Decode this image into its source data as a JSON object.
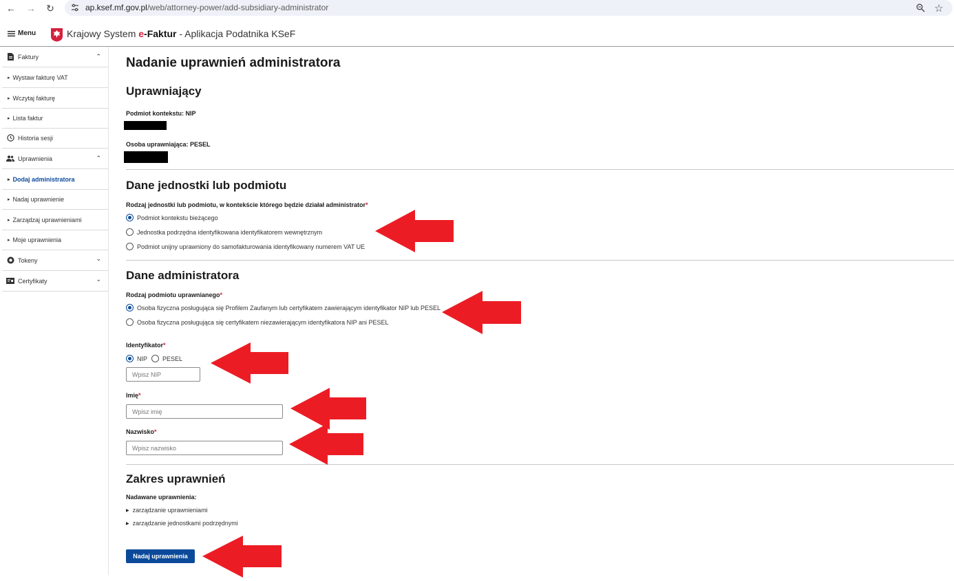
{
  "browser": {
    "url_host": "ap.ksef.mf.gov.pl",
    "url_path": "/web/attorney-power/add-subsidiary-administrator"
  },
  "header": {
    "menu_label": "Menu",
    "title_prefix": "Krajowy System ",
    "title_e": "e",
    "title_brand": "-Faktur",
    "title_suffix": " - Aplikacja Podatnika KSeF"
  },
  "sidebar": {
    "items": [
      {
        "label": "Faktury",
        "icon": "document-icon",
        "expanded": true
      },
      {
        "label": "Wystaw fakturę VAT"
      },
      {
        "label": "Wczytaj fakturę"
      },
      {
        "label": "Lista faktur"
      },
      {
        "label": "Historia sesji",
        "icon": "clock-icon"
      },
      {
        "label": "Uprawnienia",
        "icon": "people-icon",
        "expanded": true
      },
      {
        "label": "Dodaj administratora",
        "active": true
      },
      {
        "label": "Nadaj uprawnienie"
      },
      {
        "label": "Zarządzaj uprawnieniami"
      },
      {
        "label": "Moje uprawnienia"
      },
      {
        "label": "Tokeny",
        "icon": "token-icon",
        "expanded": false
      },
      {
        "label": "Certyfikaty",
        "icon": "certificate-icon",
        "expanded": false
      }
    ]
  },
  "main": {
    "page_title": "Nadanie uprawnień administratora",
    "grantor": {
      "heading": "Uprawniający",
      "context_label": "Podmiot kontekstu: NIP",
      "person_label": "Osoba uprawniająca: PESEL"
    },
    "entity": {
      "heading": "Dane jednostki lub podmiotu",
      "question": "Rodzaj jednostki lub podmiotu, w kontekście którego będzie działał administrator",
      "options": [
        {
          "label": "Podmiot kontekstu bieżącego",
          "checked": true
        },
        {
          "label": "Jednostka podrzędna identyfikowana identyfikatorem wewnętrznym",
          "checked": false
        },
        {
          "label": "Podmiot unijny uprawniony do samofakturowania identyfikowany numerem VAT UE",
          "checked": false
        }
      ]
    },
    "admin": {
      "heading": "Dane administratora",
      "type_label": "Rodzaj podmiotu uprawnianego",
      "type_options": [
        {
          "label": "Osoba fizyczna posługująca się Profilem Zaufanym lub certyfikatem zawierającym identyfikator NIP lub PESEL",
          "checked": true
        },
        {
          "label": "Osoba fizyczna posługująca się certyfikatem niezawierającym identyfikatora NIP ani PESEL",
          "checked": false
        }
      ],
      "identifier_label": "Identyfikator",
      "identifier_options": [
        {
          "label": "NIP",
          "checked": true
        },
        {
          "label": "PESEL",
          "checked": false
        }
      ],
      "nip_placeholder": "Wpisz NIP",
      "first_name_label": "Imię",
      "first_name_placeholder": "Wpisz imię",
      "last_name_label": "Nazwisko",
      "last_name_placeholder": "Wpisz nazwisko",
      "required_mark": "*"
    },
    "scope": {
      "heading": "Zakres uprawnień",
      "granted_label": "Nadawane uprawnienia:",
      "items": [
        "zarządzanie uprawnieniami",
        "zarządzanie jednostkami podrzędnymi"
      ]
    },
    "submit_label": "Nadaj uprawnienia"
  },
  "colors": {
    "primary": "#0b4a9a",
    "required": "#d4213d",
    "annotation_arrow": "#ec1c24"
  }
}
